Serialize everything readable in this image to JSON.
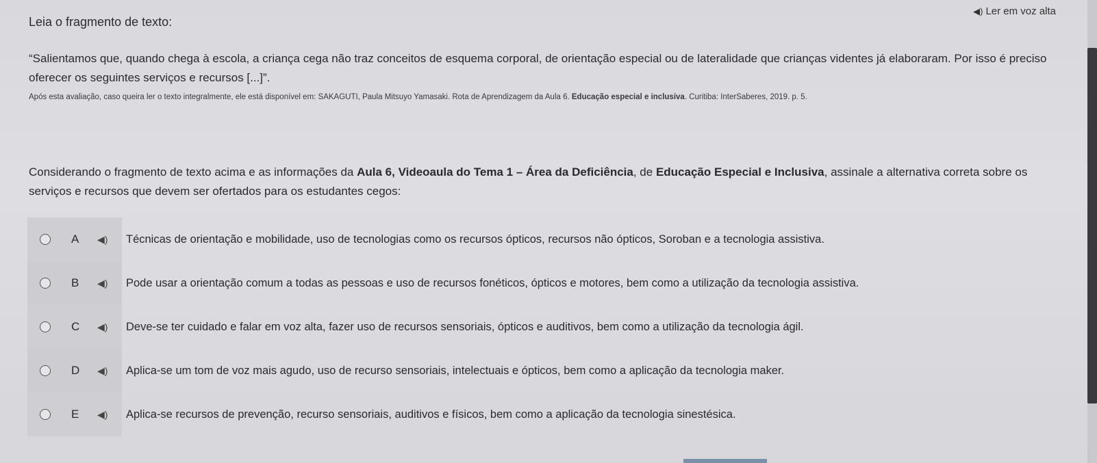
{
  "read_aloud": {
    "icon": "speaker-icon",
    "label": "Ler em voz alta"
  },
  "heading": "Leia o fragmento de texto:",
  "quote": "“Salientamos que, quando chega à escola, a criança cega não traz conceitos de esquema corporal, de orientação especial ou de lateralidade que crianças videntes já elaboraram. Por isso é preciso oferecer os seguintes serviços e recursos [...]”.",
  "citation": {
    "prefix": "Após esta avaliação, caso queira ler o texto integralmente, ele está disponível em: SAKAGUTI, Paula Mitsuyo Yamasaki. Rota de Aprendizagem da Aula 6.",
    "title": "Educação especial e inclusiva",
    "suffix": ". Curitiba: InterSaberes, 2019. p. 5."
  },
  "question": {
    "part1": "Considerando o fragmento de texto acima e as informações da ",
    "bold1": "Aula 6, Videoaula do Tema 1 – Área da Deficiência",
    "part2": ", de ",
    "bold2": "Educação Especial e Inclusiva",
    "part3": ", assinale a alternativa correta sobre os serviços e recursos que devem ser ofertados para os estudantes cegos:"
  },
  "options": [
    {
      "letter": "A",
      "text": "Técnicas de orientação e mobilidade, uso de tecnologias como os recursos ópticos, recursos não ópticos, Soroban e a tecnologia assistiva."
    },
    {
      "letter": "B",
      "text": "Pode usar a orientação comum a todas as pessoas e uso de recursos fonéticos, ópticos e motores, bem como a utilização da tecnologia assistiva."
    },
    {
      "letter": "C",
      "text": "Deve-se ter cuidado e falar em voz alta, fazer uso de recursos sensoriais, ópticos e auditivos, bem como a utilização da tecnologia ágil."
    },
    {
      "letter": "D",
      "text": "Aplica-se um tom de voz mais agudo, uso de recurso sensoriais, intelectuais e ópticos, bem como a aplicação da tecnologia maker."
    },
    {
      "letter": "E",
      "text": "Aplica-se recursos de prevenção, recurso sensoriais, auditivos e físicos, bem como a aplicação da tecnologia sinestésica."
    }
  ],
  "colors": {
    "background": "#dcdcdf",
    "text": "#2a2a2e",
    "scrollbar_thumb": "#3a3a3e"
  }
}
